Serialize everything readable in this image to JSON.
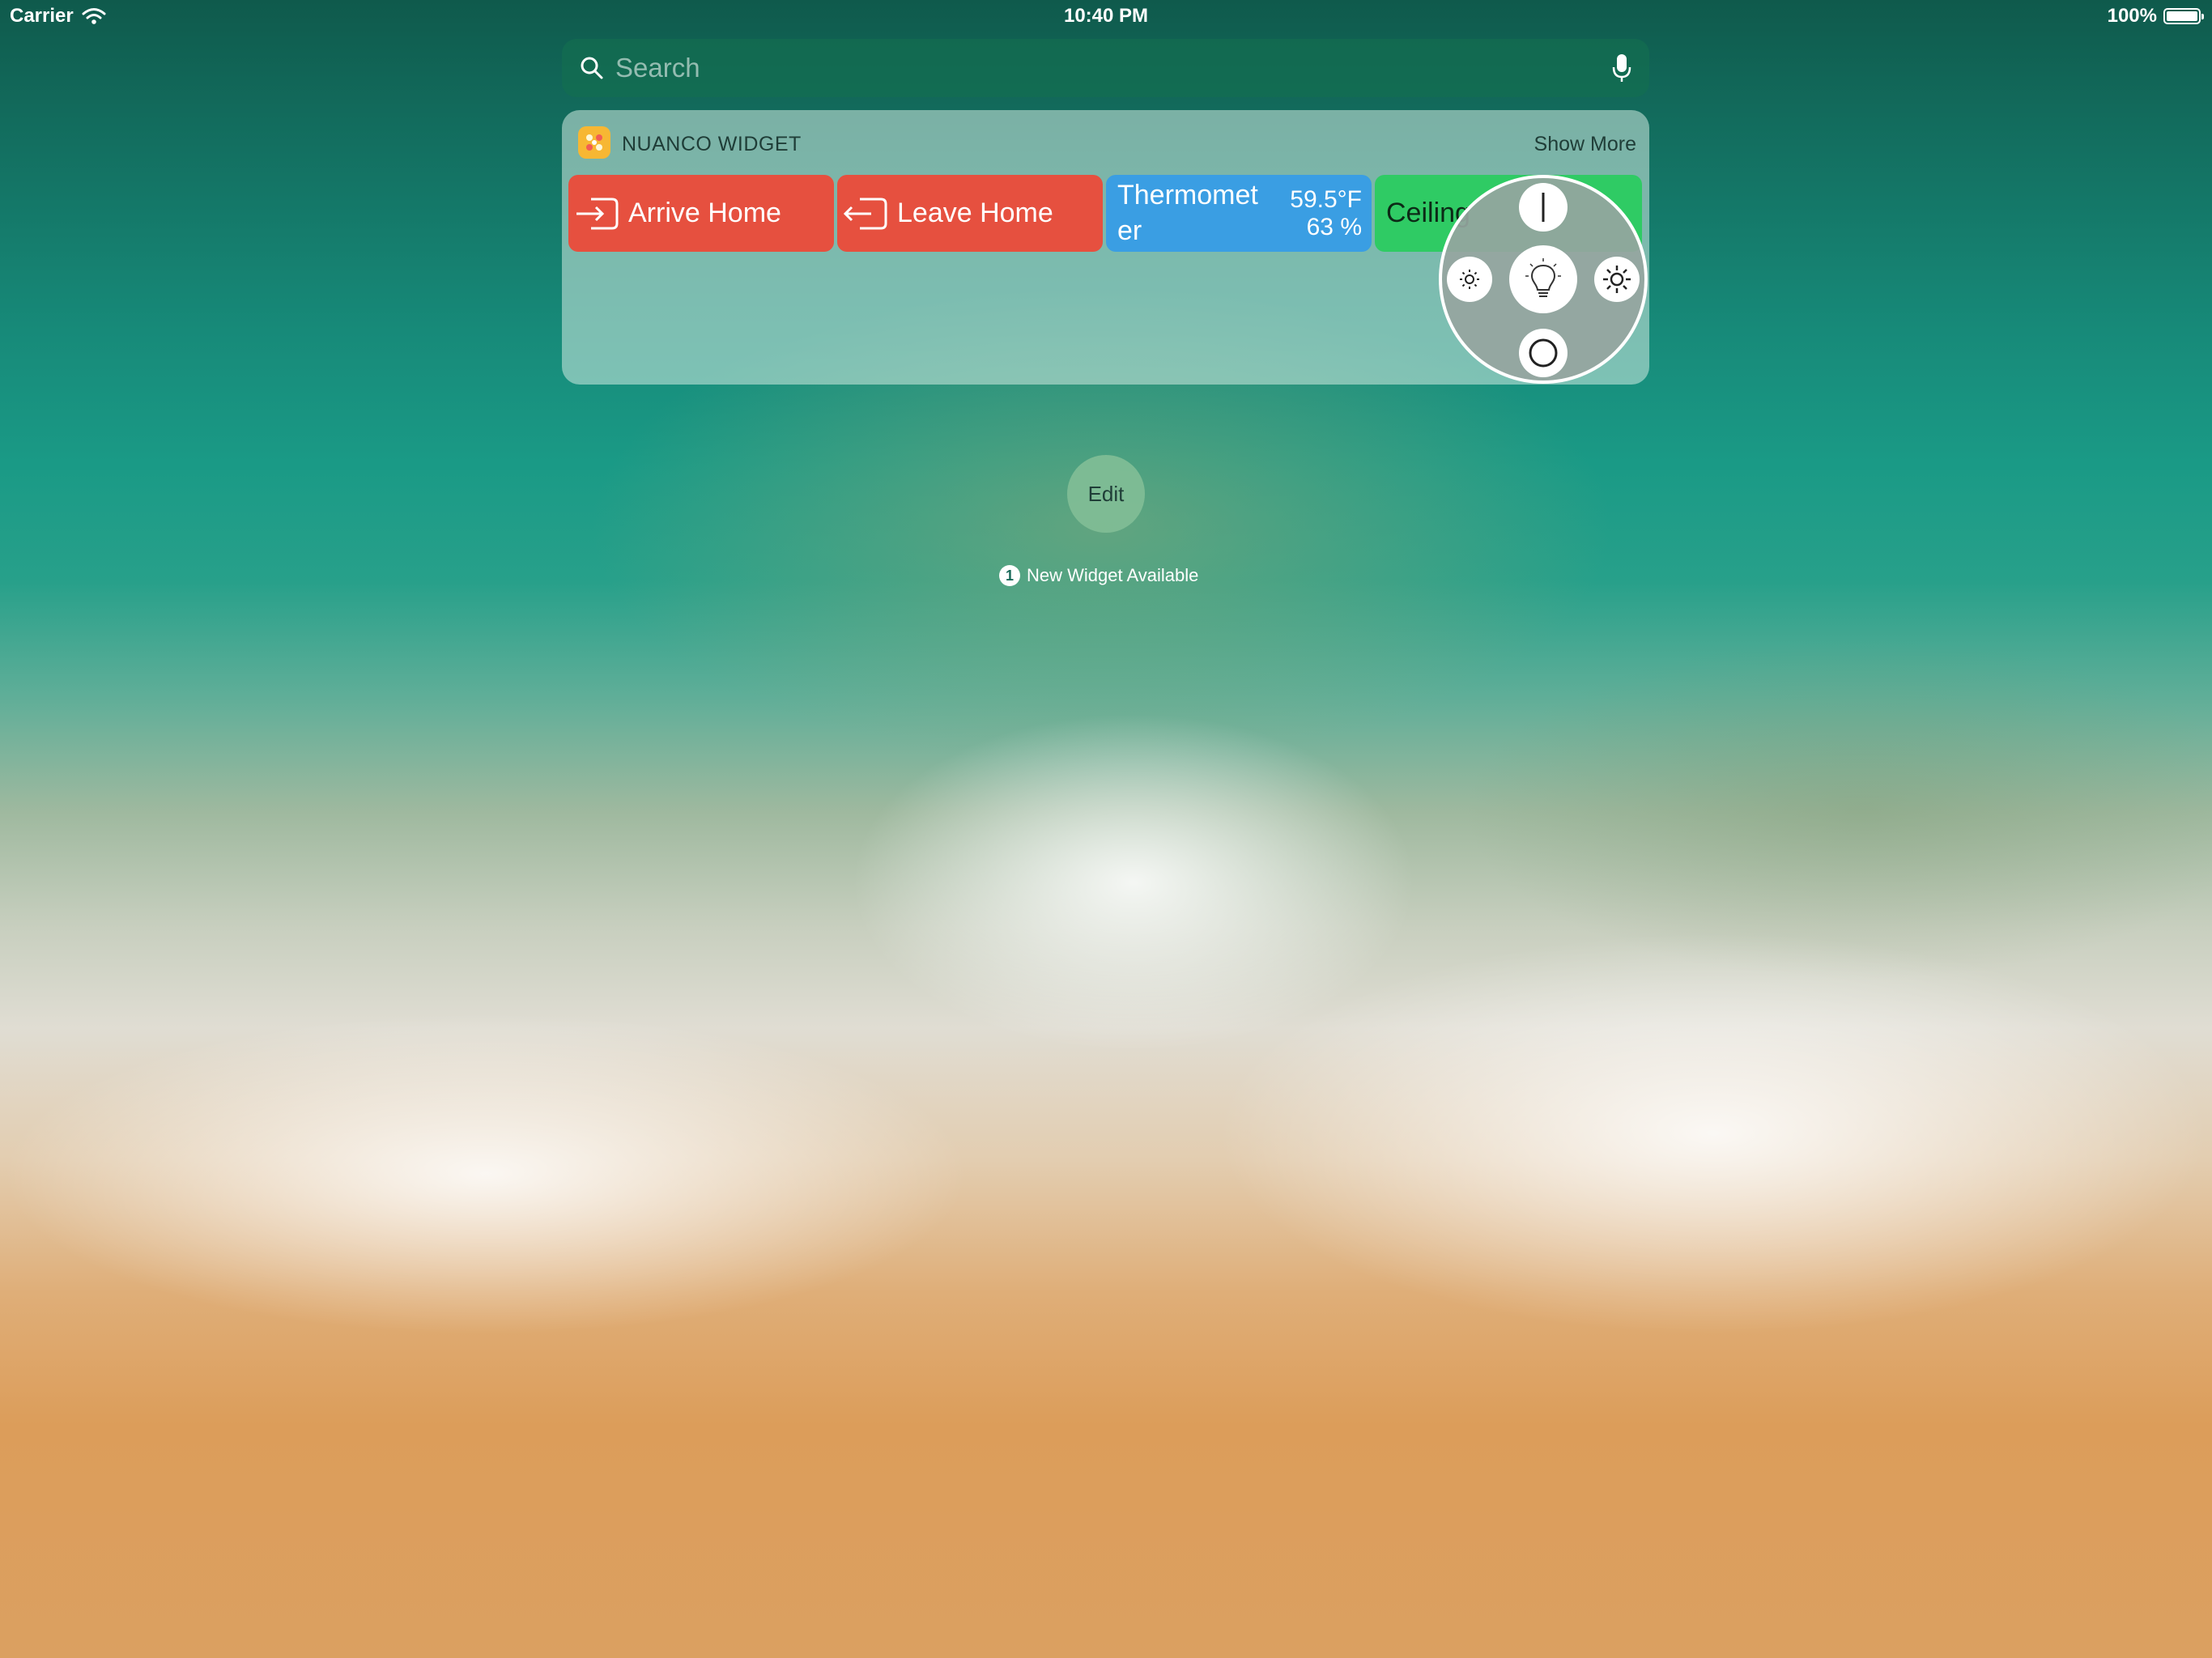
{
  "status_bar": {
    "carrier": "Carrier",
    "time": "10:40 PM",
    "battery": "100%",
    "battery_level": 1.0
  },
  "search": {
    "placeholder": "Search"
  },
  "widget": {
    "title": "NUANCO WIDGET",
    "show_more": "Show More",
    "tiles": {
      "arrive": "Arrive Home",
      "leave": "Leave Home",
      "thermometer": {
        "name_line1": "Thermomet",
        "name_line2": "er",
        "temperature": "59.5°F",
        "humidity": "63 %"
      },
      "ceiling": "Ceiling"
    }
  },
  "edit": {
    "label": "Edit"
  },
  "new_widget": {
    "count": "1",
    "text": "New Widget Available"
  },
  "colors": {
    "tile_red": "#e6503f",
    "tile_blue": "#3a9ee3",
    "tile_green": "#2fcb64",
    "app_icon": "#f7b733"
  }
}
